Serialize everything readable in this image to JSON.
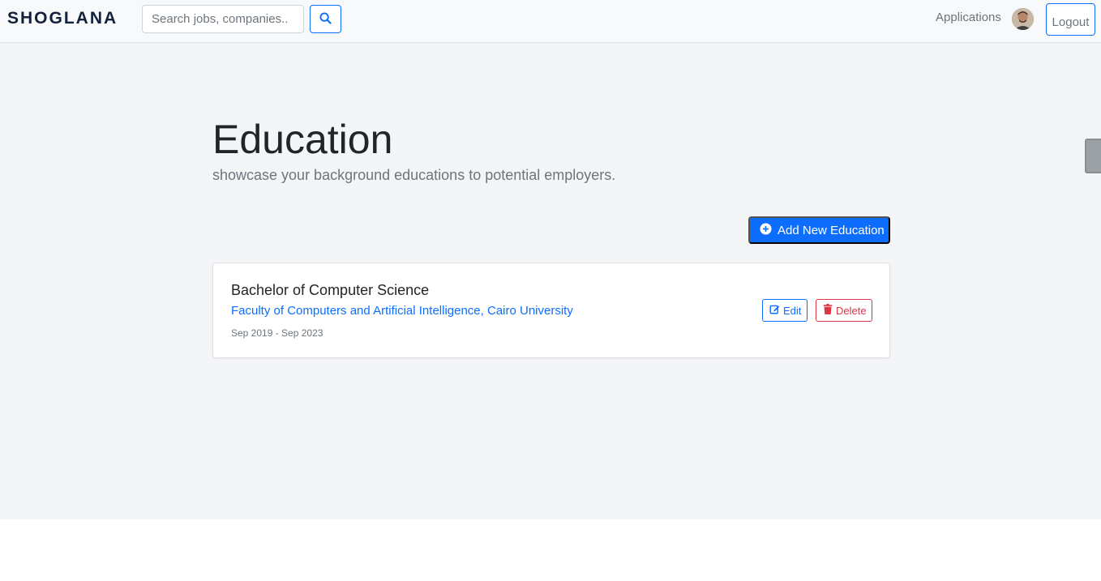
{
  "brand": "SHOGLANA",
  "search": {
    "placeholder": "Search jobs, companies.."
  },
  "nav": {
    "applications": "Applications",
    "logout": "Logout"
  },
  "header": {
    "title": "Education",
    "subtitle": "showcase your background educations to potential employers."
  },
  "add_button": "Add New Education",
  "educations": [
    {
      "degree": "Bachelor of Computer Science",
      "school": "Faculty of Computers and Artificial Intelligence, Cairo University",
      "dates": "Sep 2019 - Sep 2023",
      "edit_label": "Edit",
      "delete_label": "Delete"
    }
  ],
  "colors": {
    "primary": "#0d6efd",
    "danger": "#dc3545",
    "brand": "#14213d"
  },
  "icons": [
    "search-icon",
    "avatar",
    "plus-circle-icon",
    "edit-icon",
    "trash-icon"
  ]
}
